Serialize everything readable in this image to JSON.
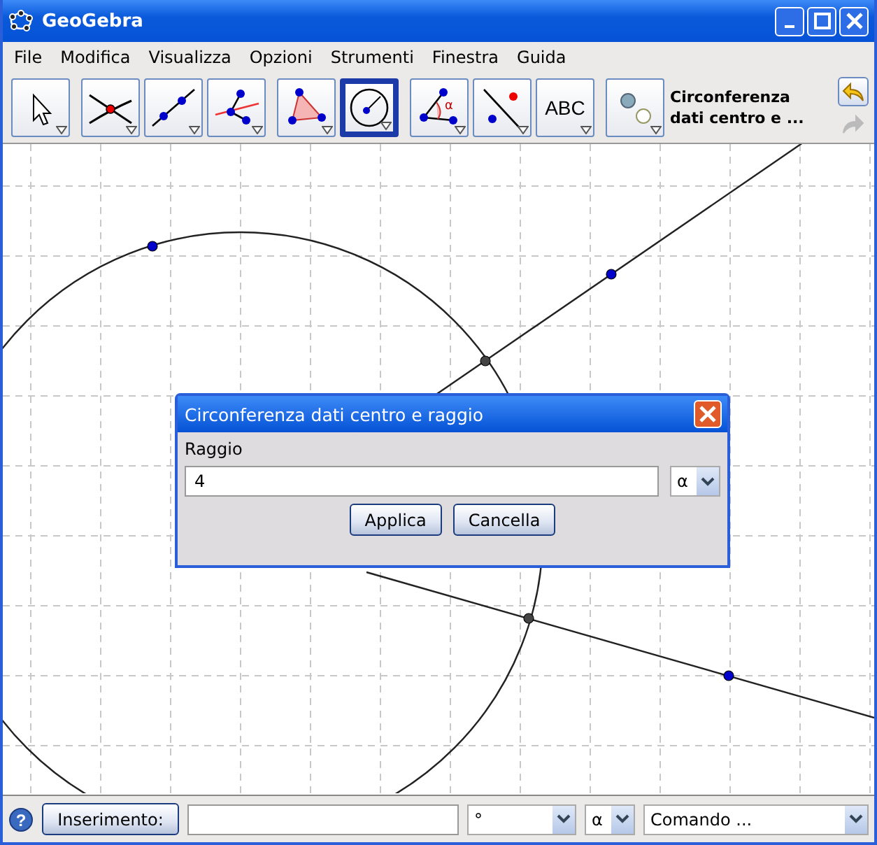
{
  "window": {
    "title": "GeoGebra"
  },
  "menu": [
    "File",
    "Modifica",
    "Visualizza",
    "Opzioni",
    "Strumenti",
    "Finestra",
    "Guida"
  ],
  "toolbar": {
    "tools": [
      {
        "kind": "pointer",
        "selected": false
      },
      {
        "kind": "intersect",
        "selected": false
      },
      {
        "kind": "line",
        "selected": false
      },
      {
        "kind": "perpendicular",
        "selected": false
      },
      {
        "kind": "polygon",
        "selected": false
      },
      {
        "kind": "circle",
        "selected": true
      },
      {
        "kind": "angle",
        "symbol": "α",
        "selected": false
      },
      {
        "kind": "reflect",
        "selected": false
      },
      {
        "kind": "text",
        "label": "ABC",
        "selected": false
      },
      {
        "kind": "visibility",
        "selected": false
      }
    ],
    "tool_name": "Circonferenza dati centro e ...",
    "undo_enabled": true,
    "redo_enabled": false
  },
  "dialog": {
    "title": "Circonferenza dati centro e raggio",
    "label": "Raggio",
    "value": "4",
    "symbol": "α",
    "buttons": [
      "Applica",
      "Cancella"
    ]
  },
  "input_bar": {
    "help": "?",
    "button": "Inserimento:",
    "degree": "°",
    "symbol": "α",
    "command": "Comando ..."
  }
}
